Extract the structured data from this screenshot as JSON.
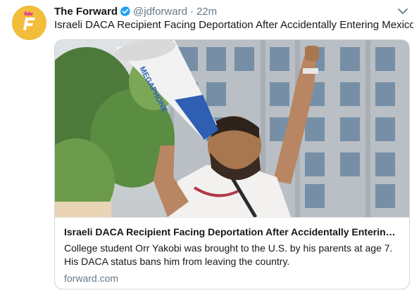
{
  "tweet": {
    "author_name": "The Forward",
    "handle": "@jdforward",
    "separator": "·",
    "timestamp": "22m",
    "text": "Israeli DACA Recipient Facing Deportation After Accidentally Entering Mexico -"
  },
  "card": {
    "title": "Israeli DACA Recipient Facing Deportation After Accidentally Enterin…",
    "description": "College student Orr Yakobi was brought to the U.S. by his parents at age 7. His DACA status bans him from leaving the country.",
    "domain": "forward.com",
    "image_icon": "protester-megaphone-photo"
  },
  "icons": {
    "avatar": "forward-logo-icon",
    "verified": "verified-badge-icon",
    "menu": "chevron-down-icon"
  },
  "colors": {
    "avatar_bg": "#f2bc3c",
    "verified": "#1da1f2",
    "secondary_text": "#657786",
    "border": "#ccd6dd"
  }
}
